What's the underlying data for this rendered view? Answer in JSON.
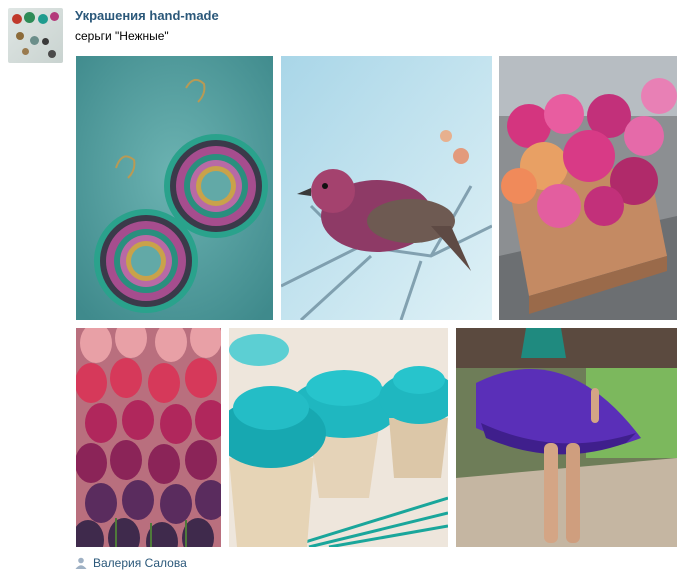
{
  "post": {
    "group_name": "Украшения hand-made",
    "text": "серьги \"Нежные\"",
    "author_name": "Валерия Салова",
    "author_icon": "person-icon",
    "avatar_icon": "group-avatar"
  },
  "photos": [
    {
      "subject": "beaded-earrings",
      "colors": [
        "#5fa4a4",
        "#2a8f86",
        "#a54b8c"
      ]
    },
    {
      "subject": "bird-on-branch",
      "colors": [
        "#b4dcea",
        "#8e3a66",
        "#cfeaf2"
      ]
    },
    {
      "subject": "flower-crate",
      "colors": [
        "#c77a5e",
        "#d4357f",
        "#e8a064"
      ]
    },
    {
      "subject": "tulips",
      "colors": [
        "#d8748e",
        "#8b2458",
        "#4f3160"
      ]
    },
    {
      "subject": "turquoise-cupcakes",
      "colors": [
        "#1fb7c0",
        "#e5d3b8",
        "#16a19a"
      ]
    },
    {
      "subject": "purple-skirt",
      "colors": [
        "#5a2fb8",
        "#7cb85d",
        "#bca78f"
      ]
    }
  ]
}
